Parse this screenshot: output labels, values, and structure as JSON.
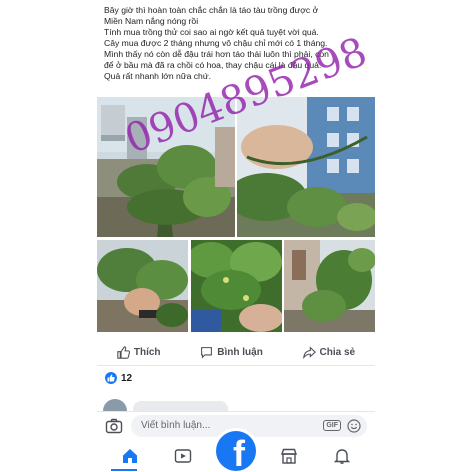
{
  "post": {
    "lines": [
      "Bây giờ thì hoàn toàn chắc chắn là táo tàu trồng được ở",
      "Miền Nam nắng nóng rồi",
      "Tính mua trồng thử coi sao ai ngờ kết quả tuyệt vời quá.",
      "Cây mua được 2 tháng nhưng vô chậu chỉ mới có 1 tháng.",
      "Mình thấy nó còn dễ đậu trái hơn táo thái luôn thì phải, còn",
      "để ở bầu mà đã ra chồi có hoa, thay chậu cái là đậu quả.",
      "Quả rất nhanh lớn nữa chứ."
    ],
    "watermark": "0904895298"
  },
  "actions": {
    "like": "Thích",
    "comment": "Bình luận",
    "share": "Chia sẻ"
  },
  "reactions": {
    "count": "12"
  },
  "composer": {
    "placeholder": "Viết bình luận...",
    "gif": "GIF"
  },
  "nav": {
    "logo": "f"
  },
  "colors": {
    "brand": "#1877f2",
    "watermark": "#9422ac",
    "action_text": "#4b4f56"
  },
  "icons": [
    "like-icon",
    "comment-icon",
    "share-icon",
    "camera-icon",
    "gif-icon",
    "emoji-icon",
    "home-icon",
    "video-icon",
    "marketplace-icon",
    "bell-icon"
  ]
}
